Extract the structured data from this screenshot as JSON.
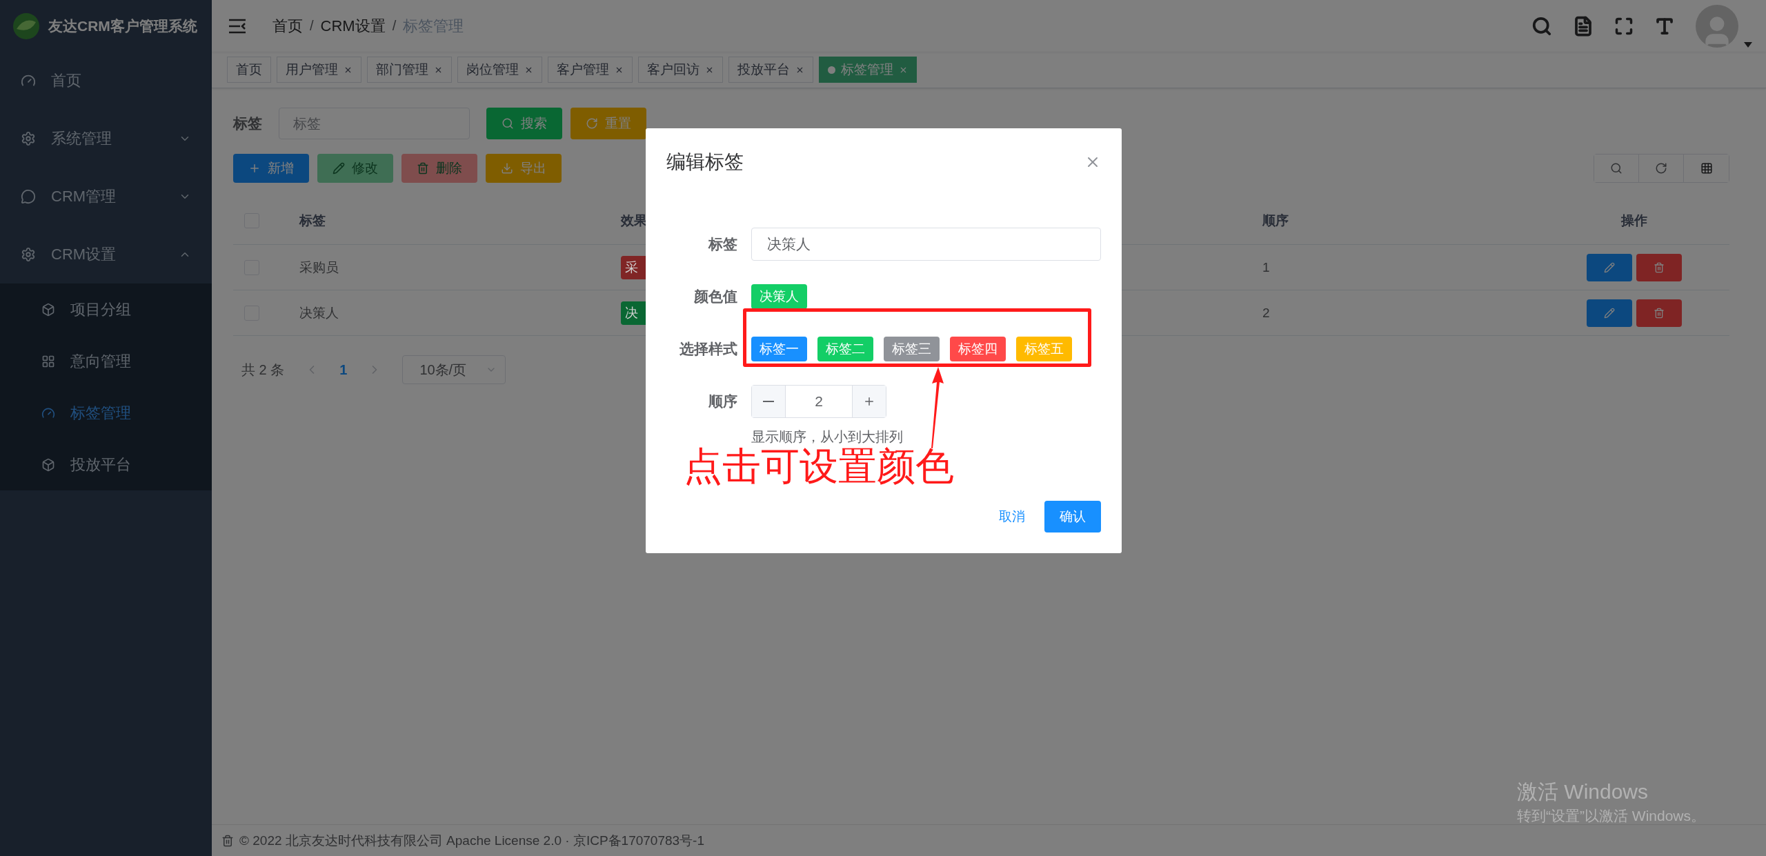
{
  "app": {
    "title": "友达CRM客户管理系统"
  },
  "sidebar": {
    "items": [
      {
        "label": "首页",
        "kind": "link"
      },
      {
        "label": "系统管理",
        "kind": "submenu",
        "expanded": false
      },
      {
        "label": "CRM管理",
        "kind": "submenu",
        "expanded": false
      },
      {
        "label": "CRM设置",
        "kind": "submenu",
        "expanded": true,
        "children": [
          {
            "label": "项目分组",
            "selected": false
          },
          {
            "label": "意向管理",
            "selected": false
          },
          {
            "label": "标签管理",
            "selected": true
          },
          {
            "label": "投放平台",
            "selected": false
          }
        ]
      }
    ]
  },
  "breadcrumbs": [
    {
      "label": "首页"
    },
    {
      "separator": "/",
      "label": "CRM设置"
    },
    {
      "separator": "/",
      "label": "标签管理"
    }
  ],
  "tabs": [
    {
      "label": "首页",
      "selected": false,
      "closable": false
    },
    {
      "label": "用户管理",
      "selected": false,
      "closable": true
    },
    {
      "label": "部门管理",
      "selected": false,
      "closable": true
    },
    {
      "label": "岗位管理",
      "selected": false,
      "closable": true
    },
    {
      "label": "客户管理",
      "selected": false,
      "closable": true
    },
    {
      "label": "客户回访",
      "selected": false,
      "closable": true
    },
    {
      "label": "投放平台",
      "selected": false,
      "closable": true
    },
    {
      "label": "标签管理",
      "selected": true,
      "closable": true
    }
  ],
  "search": {
    "label": "标签",
    "placeholder": "标签",
    "buttons": [
      {
        "label": "搜索",
        "kind": "search"
      },
      {
        "label": "重置",
        "kind": "reset"
      }
    ]
  },
  "toolbar": [
    {
      "label": "新增",
      "kind": "add",
      "disabled": false
    },
    {
      "label": "修改",
      "kind": "edit",
      "disabled": true
    },
    {
      "label": "删除",
      "kind": "delete",
      "disabled": true
    },
    {
      "label": "导出",
      "kind": "export",
      "disabled": false
    }
  ],
  "table": {
    "header_checked": false,
    "columns": [
      "标签",
      "效果",
      "顺序",
      "操作"
    ],
    "rows": [
      {
        "checked": false,
        "label": "采购员",
        "effect": {
          "text": "采",
          "color": "#802525"
        },
        "order": "1"
      },
      {
        "checked": false,
        "label": "决策人",
        "effect": {
          "text": "决",
          "color": "#0a6733"
        },
        "order": "2"
      }
    ]
  },
  "pagination": {
    "total": "共 2 条",
    "pages": [
      {
        "label": "1",
        "selected": true
      }
    ],
    "page_size": "10条/页"
  },
  "footer": "© 2022 北京友达时代科技有限公司 Apache License 2.0 · 京ICP备17070783号-1",
  "dialog": {
    "title": "编辑标签",
    "tag_field": {
      "label": "标签",
      "value": "决策人"
    },
    "color_field": {
      "label": "颜色值",
      "preview": {
        "text": "决策人",
        "color": "#13ce66"
      }
    },
    "style_field": {
      "label": "选择样式",
      "options": [
        {
          "text": "标签一",
          "color": "#1890ff"
        },
        {
          "text": "标签二",
          "color": "#13ce66"
        },
        {
          "text": "标签三",
          "color": "#909399"
        },
        {
          "text": "标签四",
          "color": "#ff4949"
        },
        {
          "text": "标签五",
          "color": "#ffba00"
        }
      ]
    },
    "order_field": {
      "label": "顺序",
      "value": "2",
      "hint": "显示顺序，从小到大排列"
    },
    "buttons": [
      {
        "label": "取消",
        "kind": "text"
      },
      {
        "label": "确认",
        "kind": "primary"
      }
    ]
  },
  "annotation": {
    "text": "点击可设置颜色"
  },
  "os_notice": {
    "title": "激活 Windows",
    "message": "转到“设置”以激活 Windows。"
  }
}
